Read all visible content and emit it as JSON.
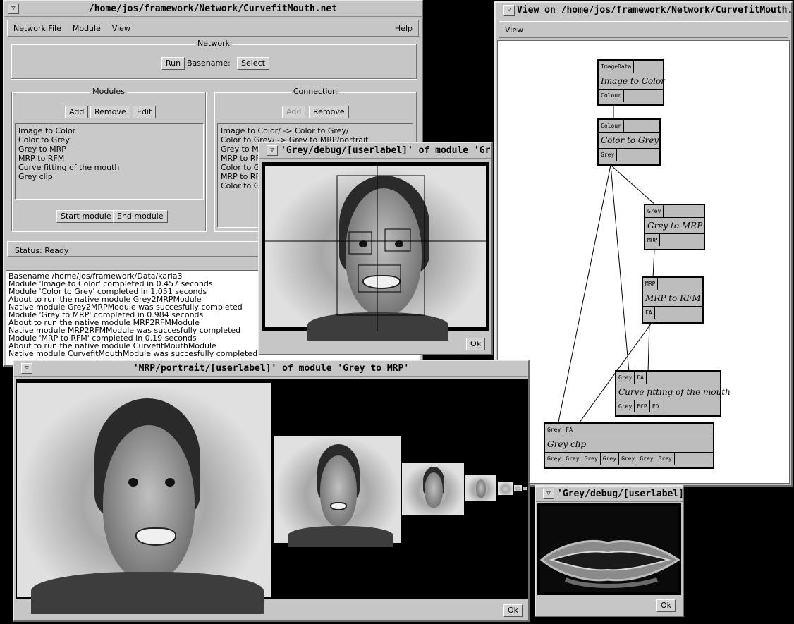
{
  "main_window": {
    "title": "/home/jos/framework/Network/CurvefitMouth.net",
    "menu": [
      "Network File",
      "Module",
      "View"
    ],
    "help": "Help",
    "network_group": "Network",
    "run_button": "Run",
    "basename_label": "Basename:",
    "select_button": "Select",
    "modules_group": "Modules",
    "modules_buttons": [
      "Add",
      "Remove",
      "Edit"
    ],
    "modules_list": [
      "Image to Color",
      "Color to Grey",
      "Grey to MRP",
      "MRP to RFM",
      "Curve fitting of the mouth",
      "Grey clip"
    ],
    "start_module": "Start module",
    "end_module": "End module",
    "connection_group": "Connection",
    "connection_buttons": [
      "Add",
      "Remove"
    ],
    "connection_list": [
      "Image to Color/ -> Color to Grey/",
      "Color to Grey/ -> Grey to MRP/portrait",
      "Grey to MRP",
      "MRP to RFM",
      "Color to Gr",
      "MRP to RF",
      "Color to Gr"
    ],
    "status": "Status: Ready",
    "log": [
      "Basename /home/jos/framework/Data/karla3",
      "Module 'Image to Color' completed in 0.457 seconds",
      "Module 'Color to Grey' completed in 1.051 seconds",
      "About to run the native module Grey2MRPModule",
      "Native module Grey2MRPModule was succesfully completed",
      "Module 'Grey to MRP' completed in 0.984 seconds",
      "About to run the native module MRP2RFMModule",
      "Native module MRP2RFMModule was succesfully completed",
      "Module 'MRP to RFM' completed in 0.19 seconds",
      "About to run the native module CurvefitMouthModule",
      "Native module CurvefitMouthModule was succesfully completed"
    ]
  },
  "view_window": {
    "title": "View on /home/jos/framework/Network/CurvefitMouth.",
    "menu": "View",
    "nodes": [
      {
        "name": "Image to Color",
        "inputs": [
          "ImageData"
        ],
        "outputs": [
          "Colour"
        ]
      },
      {
        "name": "Color to Grey",
        "inputs": [
          "Colour"
        ],
        "outputs": [
          "Grey"
        ]
      },
      {
        "name": "Grey to MRP",
        "inputs": [
          "Grey"
        ],
        "outputs": [
          "MRP"
        ]
      },
      {
        "name": "MRP to RFM",
        "inputs": [
          "MRP"
        ],
        "outputs": [
          "FA"
        ]
      },
      {
        "name": "Curve fitting of the mouth",
        "inputs": [
          "Grey",
          "FA"
        ],
        "outputs": [
          "Grey",
          "FCP",
          "FD"
        ]
      },
      {
        "name": "Grey clip",
        "inputs": [
          "Grey",
          "FA"
        ],
        "outputs": [
          "Grey",
          "Grey",
          "Grey",
          "Grey",
          "Grey",
          "Grey",
          "Grey"
        ]
      }
    ]
  },
  "debug_window": {
    "title": "'Grey/debug/[userlabel]' of module 'Grey cl",
    "ok": "Ok"
  },
  "mrp_window": {
    "title": "'MRP/portrait/[userlabel]' of module 'Grey to MRP'",
    "ok": "Ok"
  },
  "lips_window": {
    "title": "'Grey/debug/[userlabel]'",
    "ok": "Ok"
  }
}
